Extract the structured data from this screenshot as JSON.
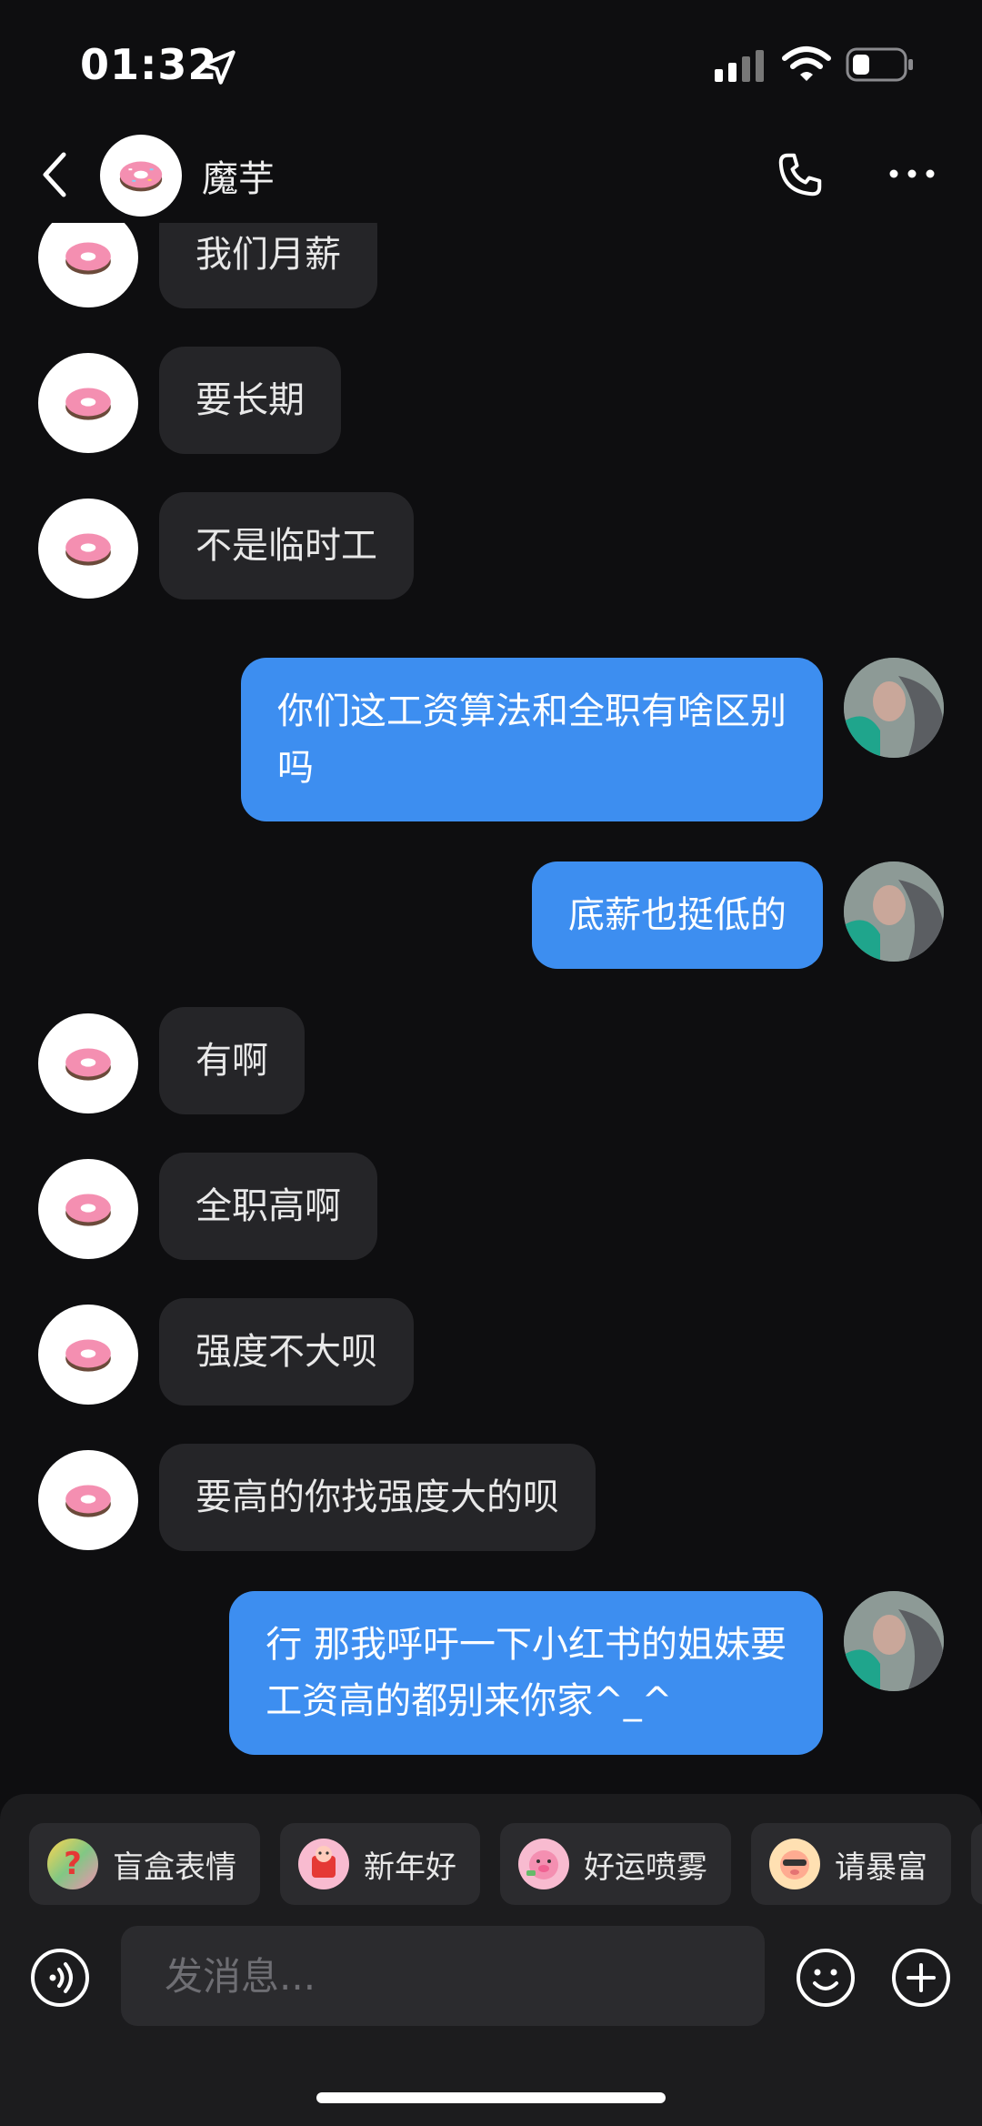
{
  "status_bar": {
    "time": "01:32"
  },
  "header": {
    "title": "魔芋"
  },
  "messages": [
    {
      "side": "in",
      "text": "我们月薪"
    },
    {
      "side": "in",
      "text": "要长期"
    },
    {
      "side": "in",
      "text": "不是临时工"
    },
    {
      "side": "out",
      "text": "你们这工资算法和全职有啥区别\n吗"
    },
    {
      "side": "out",
      "text": "底薪也挺低的"
    },
    {
      "side": "in",
      "text": "有啊"
    },
    {
      "side": "in",
      "text": "全职高啊"
    },
    {
      "side": "in",
      "text": "强度不大呗"
    },
    {
      "side": "in",
      "text": "要高的你找强度大的呗"
    },
    {
      "side": "out",
      "text": "行 那我呼吁一下小红书的姐妹要\n工资高的都别来你家^_^"
    }
  ],
  "quick_stickers": [
    {
      "label": "盲盒表情",
      "icon": "mystery-box-sticker-icon"
    },
    {
      "label": "新年好",
      "icon": "new-year-sticker-icon"
    },
    {
      "label": "好运喷雾",
      "icon": "lucky-spray-sticker-icon"
    },
    {
      "label": "请暴富",
      "icon": "get-rich-sticker-icon"
    }
  ],
  "composer": {
    "placeholder": "发消息..."
  },
  "colors": {
    "background": "#0e0e10",
    "incoming_bubble": "#252528",
    "outgoing_bubble": "#3d8ef0"
  }
}
